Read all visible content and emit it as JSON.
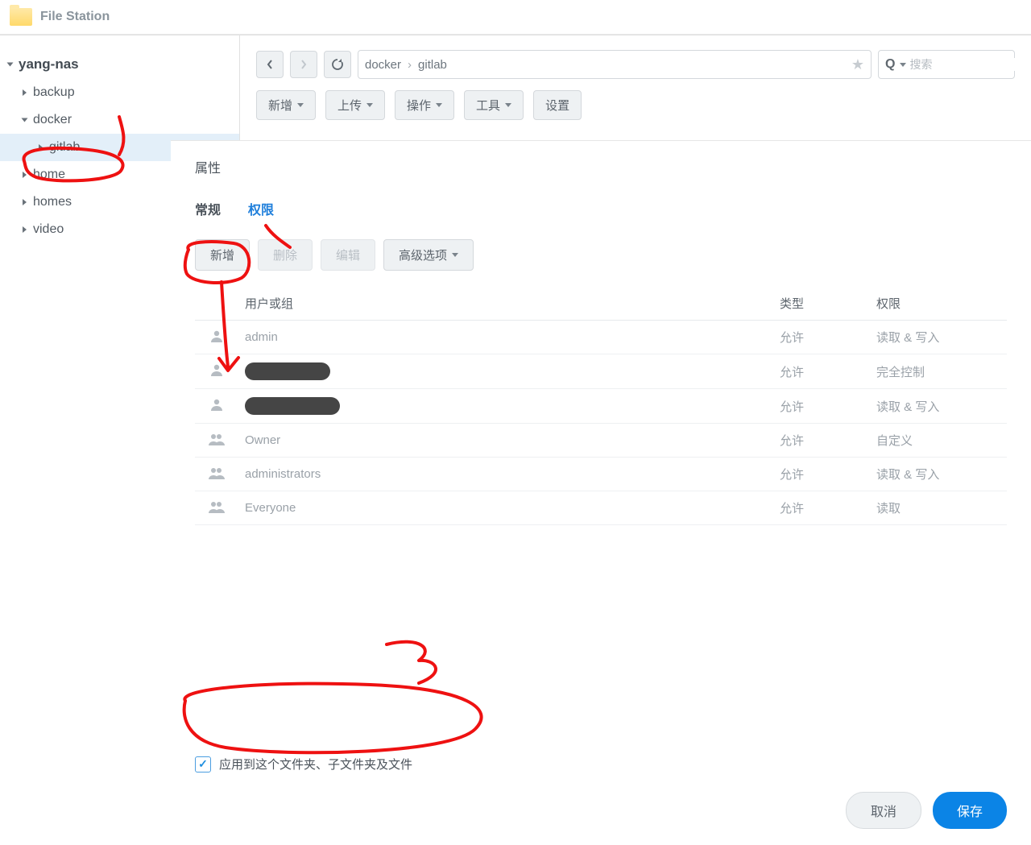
{
  "title": "File Station",
  "tree": {
    "root": "yang-nas",
    "items": [
      "backup",
      "docker",
      "gitlab",
      "home",
      "homes",
      "video"
    ],
    "expanded": "docker",
    "selected": "gitlab"
  },
  "breadcrumb": {
    "a": "docker",
    "b": "gitlab"
  },
  "search": {
    "placeholder": "搜索"
  },
  "toolbar2": {
    "new": "新增",
    "upload": "上传",
    "action": "操作",
    "tools": "工具",
    "settings": "设置"
  },
  "dialog": {
    "title": "属性",
    "tabs": {
      "general": "常规",
      "perm": "权限"
    },
    "perm_toolbar": {
      "new": "新增",
      "delete": "删除",
      "edit": "编辑",
      "advanced": "高级选项"
    },
    "columns": {
      "user": "用户或组",
      "type": "类型",
      "perm": "权限"
    },
    "rows": [
      {
        "icon": "user",
        "name": "admin",
        "redacted": false,
        "type": "允许",
        "perm": "读取 & 写入"
      },
      {
        "icon": "user",
        "name": "",
        "redacted": true,
        "type": "允许",
        "perm": "完全控制"
      },
      {
        "icon": "user",
        "name": "",
        "redacted": true,
        "type": "允许",
        "perm": "读取 & 写入"
      },
      {
        "icon": "group",
        "name": "Owner",
        "redacted": false,
        "type": "允许",
        "perm": "自定义"
      },
      {
        "icon": "group",
        "name": "administrators",
        "redacted": false,
        "type": "允许",
        "perm": "读取 & 写入"
      },
      {
        "icon": "group",
        "name": "Everyone",
        "redacted": false,
        "type": "允许",
        "perm": "读取"
      }
    ],
    "apply_label": "应用到这个文件夹、子文件夹及文件",
    "apply_checked": true,
    "buttons": {
      "cancel": "取消",
      "save": "保存"
    }
  }
}
